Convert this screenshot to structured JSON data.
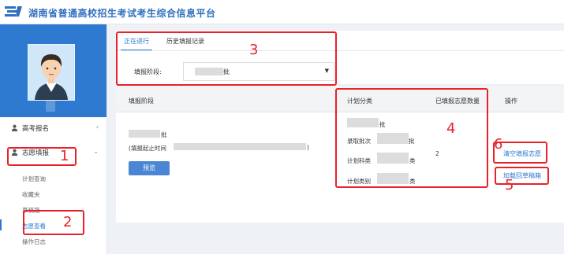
{
  "header": {
    "title": "湖南省普通高校招生考试考生综合信息平台",
    "brand_color": "#2f6fc0"
  },
  "sidebar": {
    "profile_color": "#2e7ad1",
    "menu": [
      {
        "label": "高考报名",
        "arrow": "‹"
      },
      {
        "label": "志愿填报",
        "arrow": "⌄"
      }
    ],
    "submenu": [
      "计划查询",
      "收藏夹",
      "草稿箱",
      "志愿查看",
      "操作日志"
    ]
  },
  "tabs": [
    {
      "label": "正在进行",
      "active": true
    },
    {
      "label": "历史填报记录",
      "active": false
    }
  ],
  "stage": {
    "label": "填报阶段:",
    "selected_suffix": "批",
    "caret": "▼"
  },
  "table": {
    "headers": {
      "stage": "填报阶段",
      "plan_category": "计划分类",
      "count": "已填报志愿数量",
      "ops": "操作"
    },
    "row": {
      "stage_suffix": "批",
      "period_prefix": "(填报起止时间",
      "period_suffix": ")",
      "preview_button": "预览",
      "plan_batch_suffix": "批",
      "plan_admit_prefix": "录取批次",
      "plan_admit_suffix": "批",
      "plan_subject_prefix": "计划科类",
      "plan_subject_suffix": "类",
      "plan_type_prefix": "计划类别",
      "plan_type_suffix": "类",
      "count": "2",
      "op_clear": "清空填报志愿",
      "op_load": "加载回草稿箱"
    }
  },
  "annotations": [
    "1",
    "2",
    "3",
    "4",
    "5",
    "6"
  ],
  "annotation_color": "#e8222b"
}
